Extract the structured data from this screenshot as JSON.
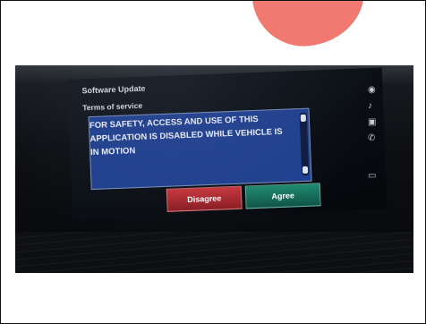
{
  "screen": {
    "title": "Software Update",
    "subtitle": "Terms of service",
    "message": "FOR SAFETY, ACCESS AND USE OF THIS APPLICATION IS DISABLED WHILE VEHICLE IS IN MOTION",
    "buttons": {
      "disagree": "Disagree",
      "agree": "Agree"
    }
  },
  "side_icons": [
    "navigation-icon",
    "music-icon",
    "image-icon",
    "phone-icon",
    "card-icon"
  ],
  "colors": {
    "terms_box": "#1f3f8f",
    "disagree": "#c9363b",
    "agree": "#1f8a72",
    "blob": "#f07a72"
  }
}
